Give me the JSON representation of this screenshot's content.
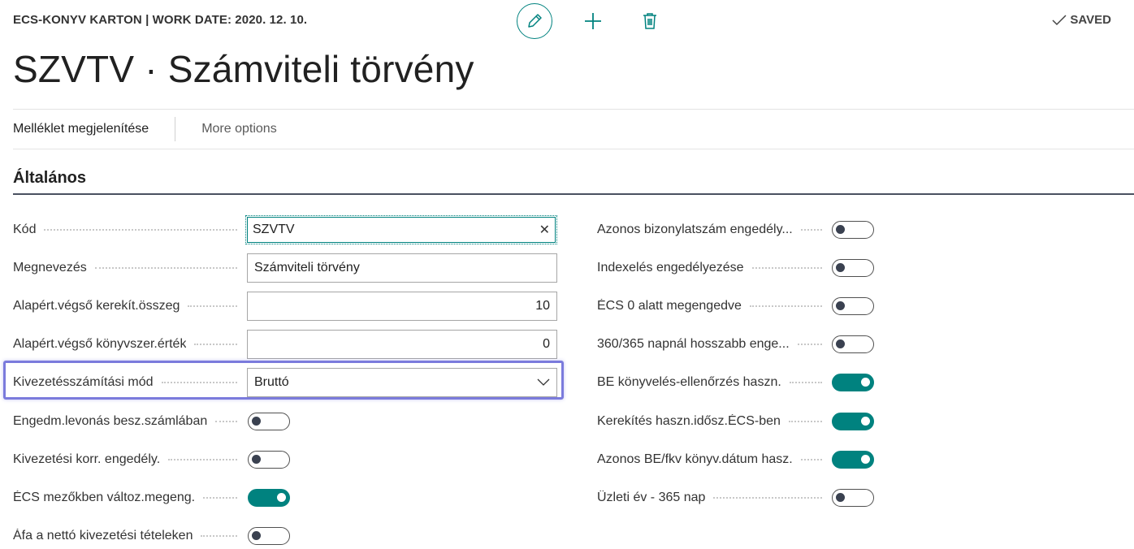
{
  "header": {
    "breadcrumb": "ECS-KONYV KARTON | WORK DATE: 2020. 12. 10.",
    "saved_label": "SAVED",
    "title": "SZVTV · Számviteli törvény"
  },
  "actions": {
    "show_attachment": "Melléklet megjelenítése",
    "more_options": "More options"
  },
  "section": {
    "title": "Általános"
  },
  "left_fields": {
    "kod": {
      "label": "Kód",
      "value": "SZVTV"
    },
    "megnevezes": {
      "label": "Megnevezés",
      "value": "Számviteli törvény"
    },
    "kerekit_osszeg": {
      "label": "Alapért.végső kerekít.összeg",
      "value": "10"
    },
    "konyvszer_ertek": {
      "label": "Alapért.végső könyvszer.érték",
      "value": "0"
    },
    "kivezetes_mod": {
      "label": "Kivezetésszámítási mód",
      "value": "Bruttó"
    },
    "engedm_levonas": {
      "label": "Engedm.levonás besz.számlában",
      "on": false
    },
    "kivezetesi_korr": {
      "label": "Kivezetési korr. engedély.",
      "on": false
    },
    "ecs_mezokben": {
      "label": "ÉCS mezőkben változ.megeng.",
      "on": true
    },
    "afa_netto": {
      "label": "Áfa a nettó kivezetési tételeken",
      "on": false
    }
  },
  "right_fields": {
    "azonos_bizonylat": {
      "label": "Azonos bizonylatszám engedély...",
      "on": false
    },
    "indexeles": {
      "label": "Indexelés engedélyezése",
      "on": false
    },
    "ecs_0_alatt": {
      "label": "ÉCS 0 alatt megengedve",
      "on": false
    },
    "napnal_hosszabb": {
      "label": "360/365 napnál hosszabb enge...",
      "on": false
    },
    "be_konyveles": {
      "label": "BE könyvelés-ellenőrzés haszn.",
      "on": true
    },
    "kerekites": {
      "label": "Kerekítés haszn.idősz.ÉCS-ben",
      "on": true
    },
    "azonos_be_fkv": {
      "label": "Azonos BE/fkv könyv.dátum hasz.",
      "on": true
    },
    "uzleti_ev": {
      "label": "Üzleti év - 365 nap",
      "on": false
    }
  },
  "colors": {
    "accent": "#00827f",
    "focus_highlight": "#7b7bdc"
  }
}
